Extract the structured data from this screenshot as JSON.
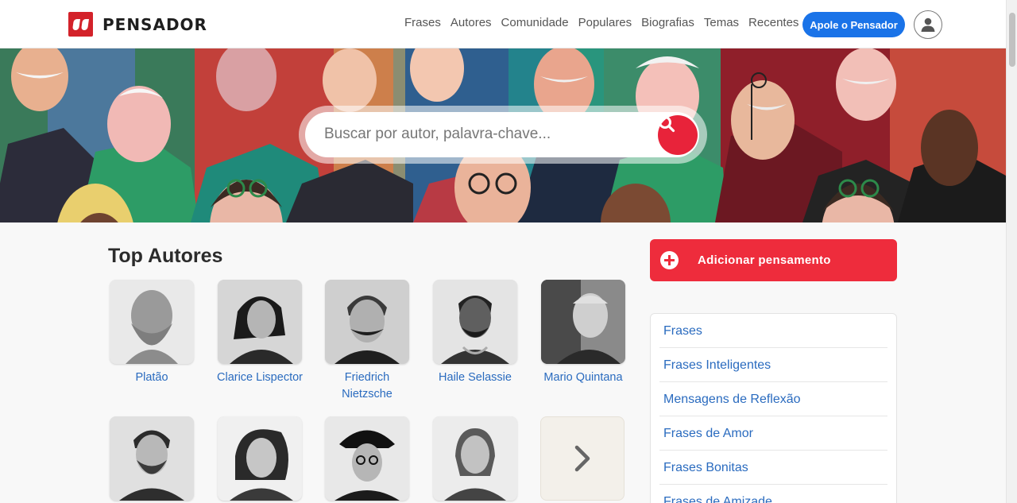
{
  "header": {
    "logo_text": "PENSADOR",
    "nav": [
      "Frases",
      "Autores",
      "Comunidade",
      "Populares",
      "Biografias",
      "Temas",
      "Recentes"
    ],
    "support_label": "Apole o Pensador"
  },
  "search": {
    "placeholder": "Buscar por autor, palavra-chave..."
  },
  "top_authors": {
    "title": "Top Autores",
    "authors": [
      "Platão",
      "Clarice Lispector",
      "Friedrich Nietzsche",
      "Haile Selassie",
      "Mario Quintana",
      "",
      "",
      "",
      ""
    ]
  },
  "sidebar": {
    "add_label": "Adicionar pensamento",
    "categories": [
      "Frases",
      "Frases Inteligentes",
      "Mensagens de Reflexão",
      "Frases de Amor",
      "Frases Bonitas",
      "Frases de Amizade"
    ]
  },
  "colors": {
    "accent_blue": "#1a73e8",
    "brand_red": "#d3222a",
    "add_red": "#ee2c3c",
    "link_blue": "#2a6bbf"
  }
}
